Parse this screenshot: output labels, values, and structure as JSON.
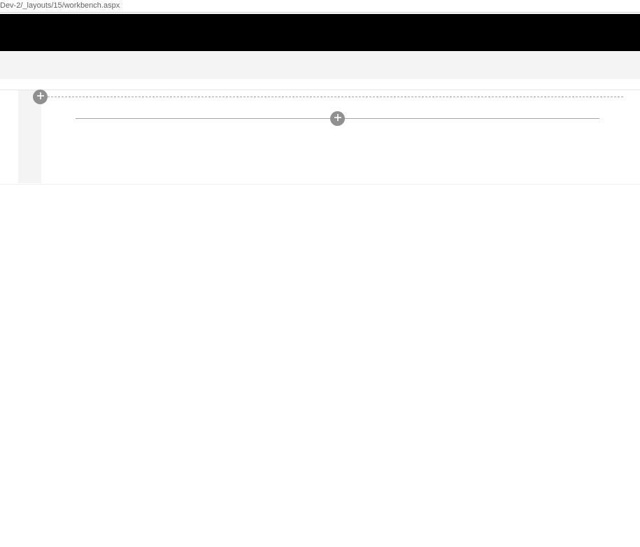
{
  "addressBar": {
    "url": "Dev-2/_layouts/15/workbench.aspx"
  },
  "icons": {
    "plus": "plus"
  }
}
